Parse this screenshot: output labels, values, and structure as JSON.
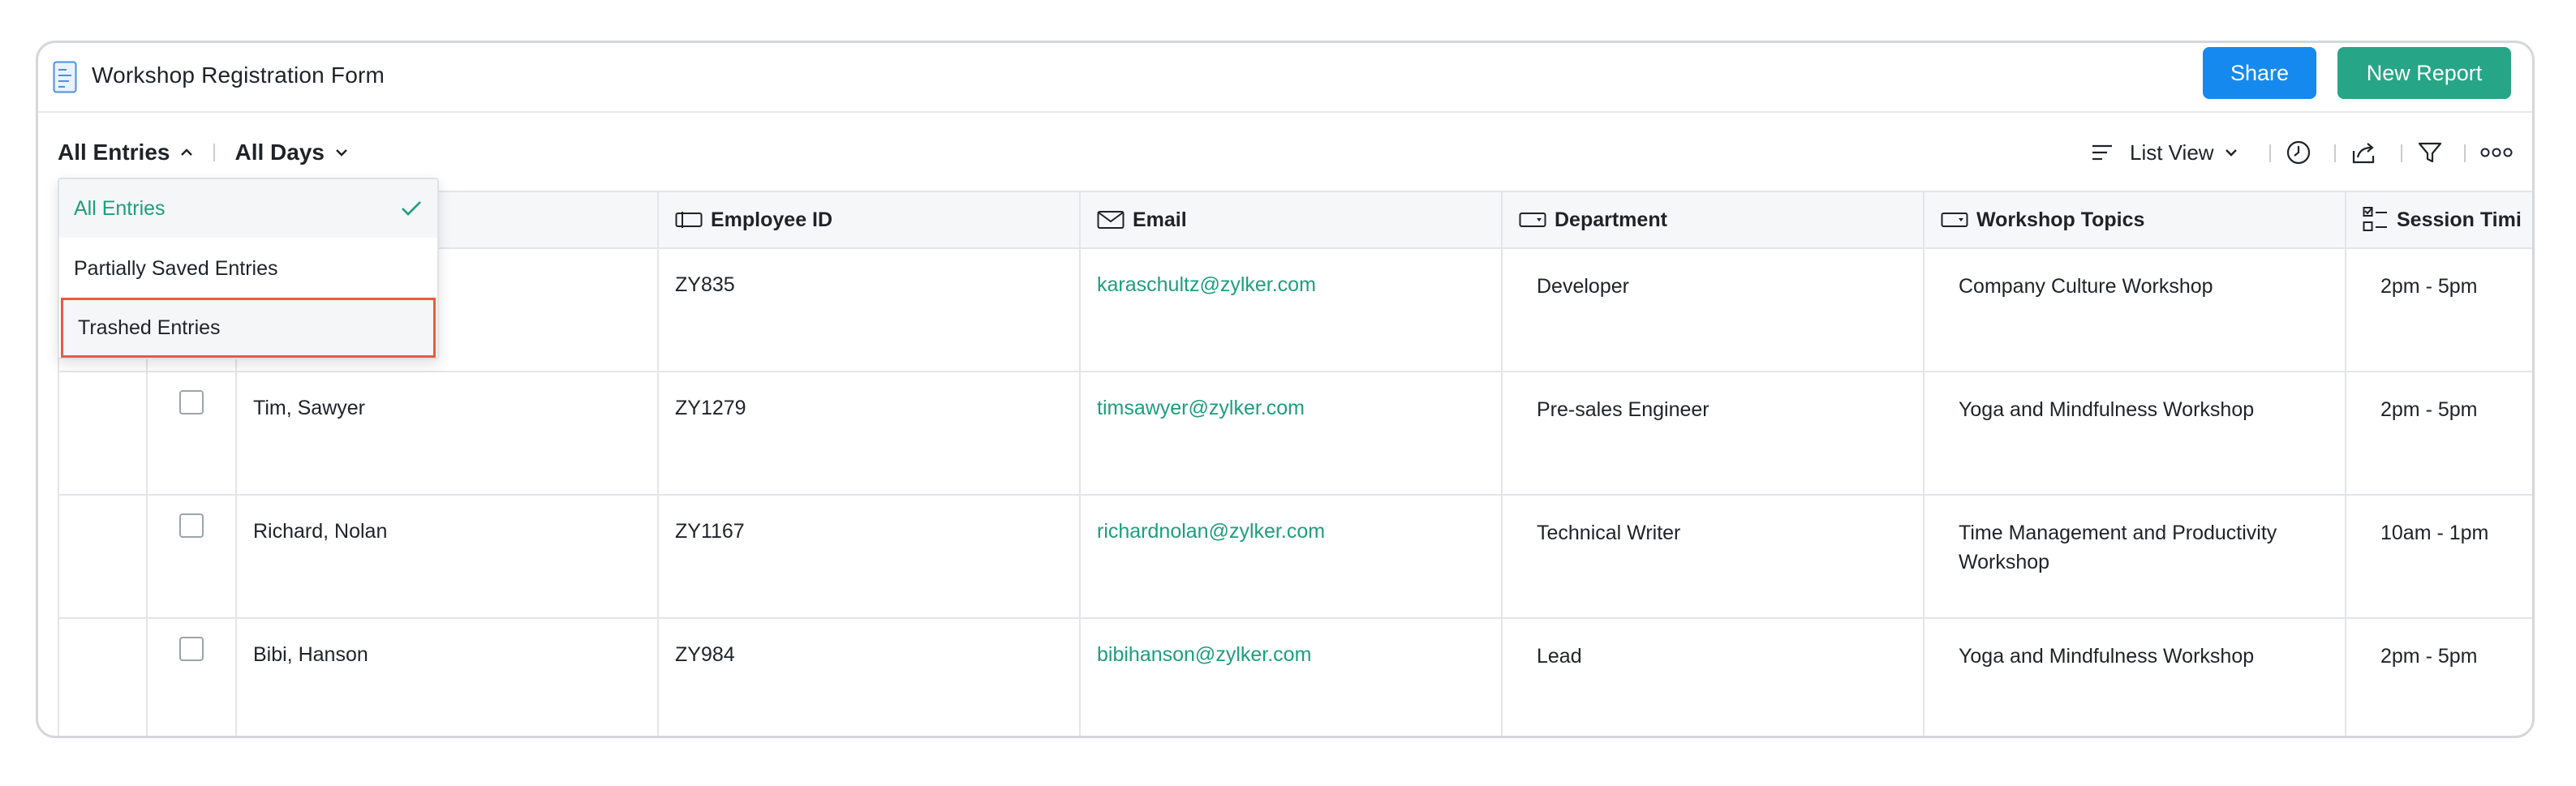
{
  "header": {
    "form_title": "Workshop Registration Form",
    "share_label": "Share",
    "new_report_label": "New Report"
  },
  "toolbar": {
    "entries_filter": "All Entries",
    "days_filter": "All Days",
    "view_label": "List View"
  },
  "dropdown": {
    "items": [
      {
        "label": "All Entries",
        "selected": true
      },
      {
        "label": "Partially Saved Entries",
        "selected": false
      },
      {
        "label": "Trashed Entries",
        "selected": false,
        "highlighted": true
      }
    ]
  },
  "table": {
    "columns": [
      "Employee ID",
      "Email",
      "Department",
      "Workshop Topics",
      "Session Timi"
    ],
    "rows": [
      {
        "name": "",
        "id": "ZY835",
        "email": "karaschultz@zylker.com",
        "department": "Developer",
        "topic": "Company Culture Workshop",
        "session": "2pm - 5pm"
      },
      {
        "name": "Tim, Sawyer",
        "id": "ZY1279",
        "email": "timsawyer@zylker.com",
        "department": "Pre-sales Engineer",
        "topic": "Yoga and Mindfulness Workshop",
        "session": "2pm - 5pm"
      },
      {
        "name": "Richard, Nolan",
        "id": "ZY1167",
        "email": "richardnolan@zylker.com",
        "department": "Technical Writer",
        "topic": "Time Management and Productivity Workshop",
        "session": "10am - 1pm"
      },
      {
        "name": "Bibi, Hanson",
        "id": "ZY984",
        "email": "bibihanson@zylker.com",
        "department": "Lead",
        "topic": "Yoga and Mindfulness Workshop",
        "session": "2pm - 5pm"
      }
    ]
  },
  "colors": {
    "primary_blue": "#1589ee",
    "primary_green": "#27a587",
    "link_green": "#1c9e7f",
    "highlight_border": "#e85c3c"
  }
}
